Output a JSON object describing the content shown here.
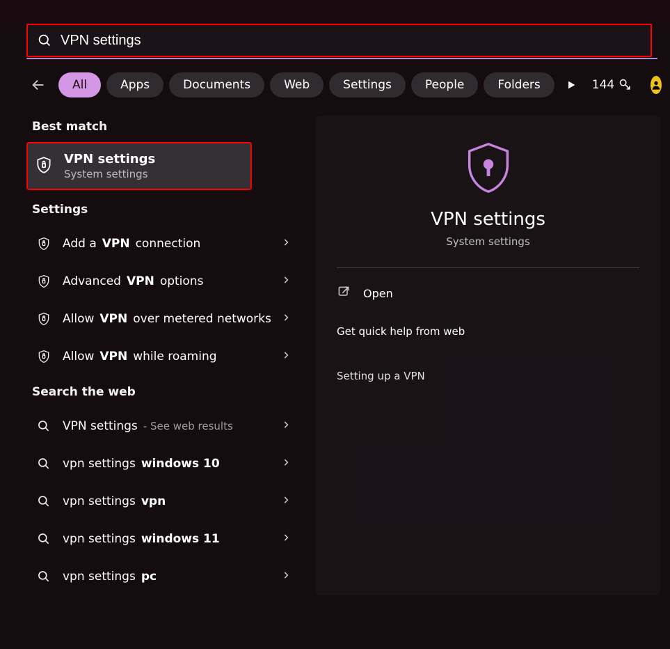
{
  "search": {
    "value": "VPN settings"
  },
  "filters": {
    "items": [
      "All",
      "Apps",
      "Documents",
      "Web",
      "Settings",
      "People",
      "Folders"
    ],
    "active_index": 0,
    "rewards_count": "144"
  },
  "sections": {
    "best_match_label": "Best match",
    "best_match": {
      "title": "VPN settings",
      "subtitle": "System settings"
    },
    "settings_label": "Settings",
    "settings_items": [
      {
        "html": "Add a <b>VPN</b> connection"
      },
      {
        "html": "Advanced <b>VPN</b> options"
      },
      {
        "html": "Allow <b>VPN</b> over metered networks"
      },
      {
        "html": "Allow <b>VPN</b> while roaming"
      }
    ],
    "web_label": "Search the web",
    "web_items": [
      {
        "primary": "VPN settings",
        "secondary": "- See web results"
      },
      {
        "html": "vpn settings <b>windows 10</b>"
      },
      {
        "html": "vpn settings <b>vpn</b>"
      },
      {
        "html": "vpn settings <b>windows 11</b>"
      },
      {
        "html": "vpn settings <b>pc</b>"
      }
    ]
  },
  "detail": {
    "title": "VPN settings",
    "subtitle": "System settings",
    "open_label": "Open",
    "help_head": "Get quick help from web",
    "help_links": [
      "Setting up a VPN"
    ]
  }
}
